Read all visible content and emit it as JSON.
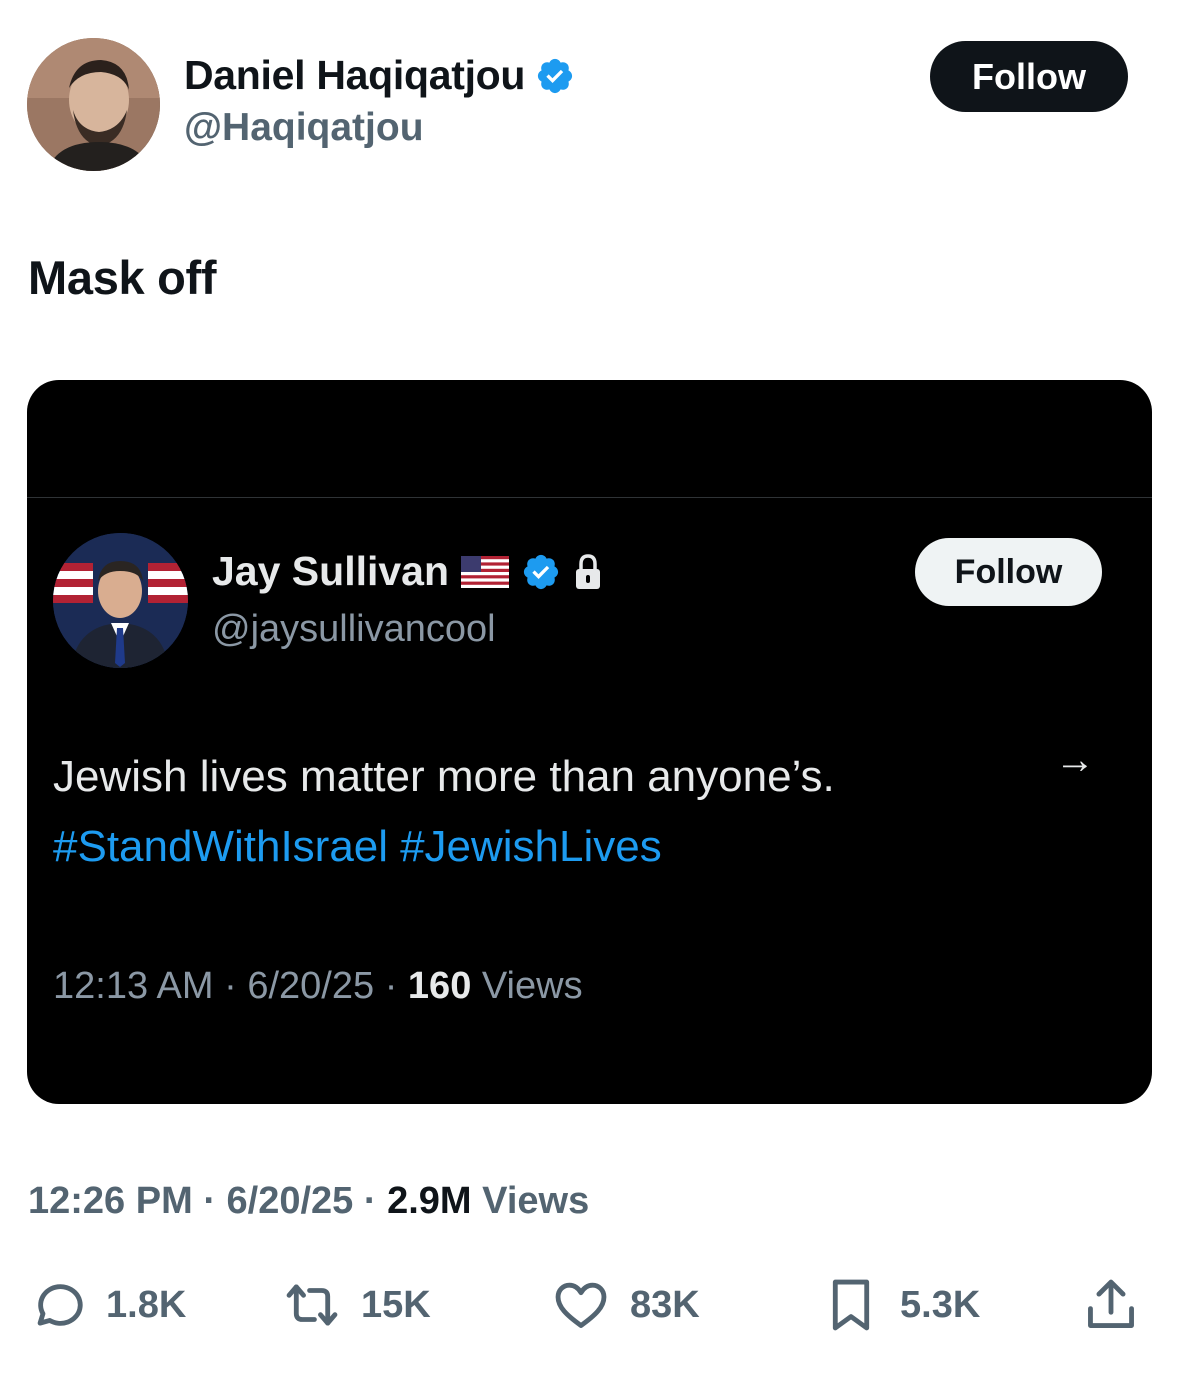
{
  "author": {
    "name": "Daniel Haqiqatjou",
    "handle": "@Haqiqatjou",
    "verified": true,
    "follow_label": "Follow"
  },
  "tweet": {
    "text": "Mask off"
  },
  "quoted": {
    "name": "Jay Sullivan",
    "handle": "@jaysullivancool",
    "follow_label": "Follow",
    "text": "Jewish lives matter more than anyone’s.",
    "hashtags": [
      "#StandWithIsrael",
      "#JewishLives"
    ],
    "time": "12:13 AM",
    "date": "6/20/25",
    "views_count": "160",
    "views_label": "Views",
    "arrow": "→"
  },
  "meta": {
    "time": "12:26 PM",
    "date": "6/20/25",
    "views_count": "2.9M",
    "views_label": "Views",
    "separator": "·"
  },
  "actions": {
    "replies": "1.8K",
    "reposts": "15K",
    "likes": "83K",
    "bookmarks": "5.3K"
  },
  "colors": {
    "verified_blue": "#1d9bf0",
    "hashtag_blue": "#1d9bf0",
    "muted": "#536471"
  },
  "icons": [
    "verified-badge-icon",
    "us-flag-icon",
    "lock-icon",
    "arrow-right-icon",
    "reply-icon",
    "repost-icon",
    "like-icon",
    "bookmark-icon",
    "share-icon"
  ]
}
